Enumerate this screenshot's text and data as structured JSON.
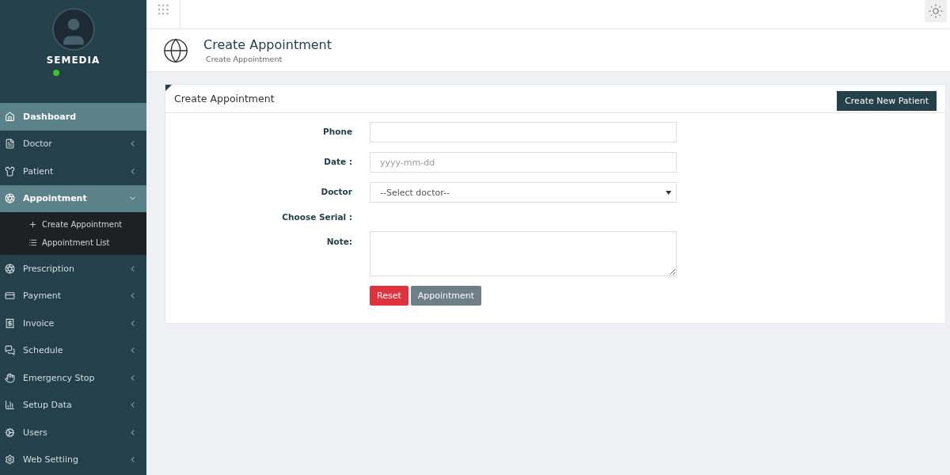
{
  "profile": {
    "name": "SEMEDIA",
    "online": true
  },
  "sidebar": {
    "items": [
      {
        "label": "Dashboard",
        "selected": true
      },
      {
        "label": "Doctor",
        "selected": false,
        "expanded": false
      },
      {
        "label": "Patient",
        "selected": false,
        "expanded": false
      },
      {
        "label": "Appointment",
        "selected": true,
        "expanded": true,
        "children": [
          {
            "label": "Create Appointment"
          },
          {
            "label": "Appointment List"
          }
        ]
      },
      {
        "label": "Prescription",
        "selected": false,
        "expanded": false
      },
      {
        "label": "Payment",
        "selected": false,
        "expanded": false
      },
      {
        "label": "Invoice",
        "selected": false,
        "expanded": false
      },
      {
        "label": "Schedule",
        "selected": false,
        "expanded": false
      },
      {
        "label": "Emergency Stop",
        "selected": false,
        "expanded": false
      },
      {
        "label": "Setup Data",
        "selected": false,
        "expanded": false
      },
      {
        "label": "Users",
        "selected": false,
        "expanded": false
      },
      {
        "label": "Web Settiing",
        "selected": false,
        "expanded": false
      }
    ]
  },
  "header": {
    "title": "Create Appointment",
    "subtitle": "Create Appointment"
  },
  "card": {
    "title": "Create Appointment",
    "action": "Create New Patient",
    "fields": [
      {
        "kind": "input",
        "label": "Phone"
      },
      {
        "kind": "input",
        "label": "Date :",
        "placeholder": "yyyy-mm-dd"
      },
      {
        "kind": "select",
        "label": "Doctor",
        "value": "--Select doctor--"
      },
      {
        "kind": "text",
        "label": "Choose Serial :"
      },
      {
        "kind": "textarea",
        "label": "Note:"
      }
    ],
    "buttons": [
      {
        "label": "Reset",
        "kind": "danger"
      },
      {
        "label": "Appointment",
        "kind": "secondary"
      }
    ]
  }
}
